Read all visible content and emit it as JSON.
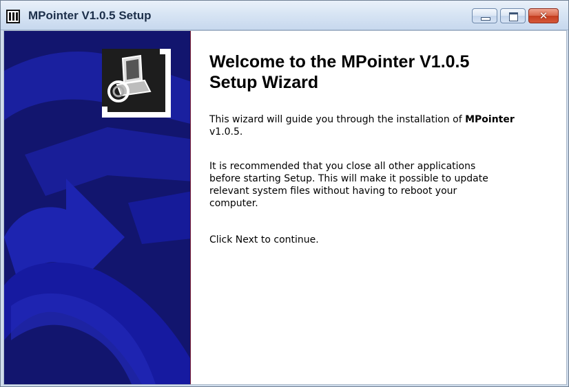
{
  "window": {
    "title": "MPointer V1.0.5 Setup",
    "close_glyph": "✕"
  },
  "welcome": {
    "title_line1": "Welcome to the MPointer V1.0.5",
    "title_line2": "Setup Wizard",
    "intro_prefix": "This wizard will guide you through the installation of ",
    "product_name": "MPointer",
    "product_version": "v1.0.5.",
    "recommend_line1": "It is recommended that you close all other applications",
    "recommend_line2": "before starting Setup. This will make it possible to update",
    "recommend_line3": "relevant system files without having to reboot your",
    "recommend_line4": "computer.",
    "continue_text": "Click Next to continue."
  },
  "colors": {
    "banner_background": "#12156e",
    "banner_graphic": "#1c22a8",
    "title_text": "#000000"
  },
  "icons": {
    "app": "app-icon",
    "installer_logo": "installer-computer-icon",
    "banner_art": "arrow-graphic"
  }
}
